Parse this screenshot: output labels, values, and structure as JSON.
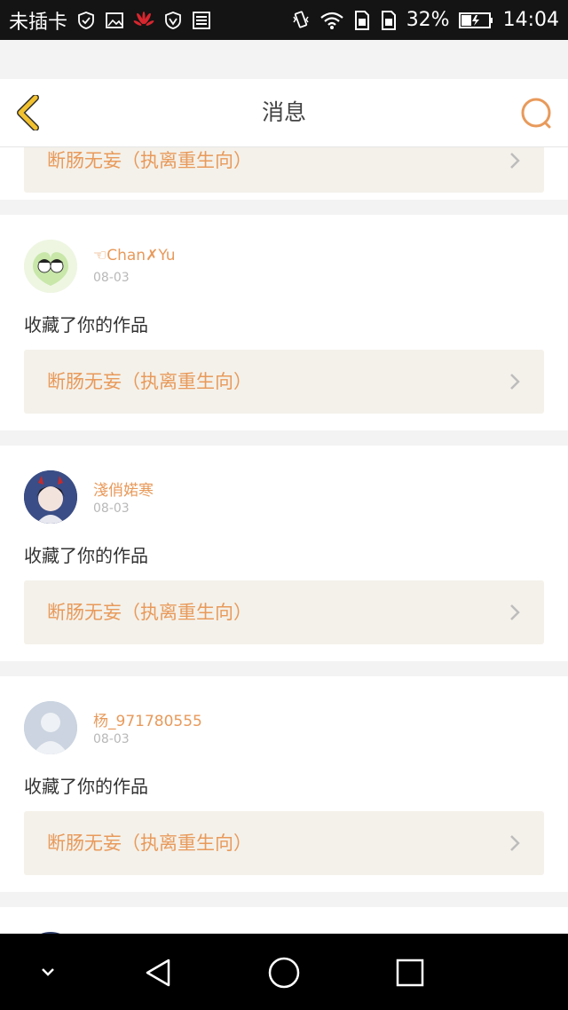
{
  "status_bar": {
    "carrier": "未插卡",
    "battery_percent": "32%",
    "time": "14:04",
    "icons": [
      "shield-check-icon",
      "image-icon",
      "huawei-logo-icon",
      "vpn-shield-icon",
      "storage-icon",
      "vibrate-icon",
      "wifi-icon",
      "sim1-icon",
      "sim2-icon",
      "battery-charging-icon"
    ]
  },
  "header": {
    "title": "消息",
    "back_icon": "chevron-left-icon",
    "search_icon": "search-icon"
  },
  "colors": {
    "accent": "#e89a5b",
    "back_arrow": "#f2c12e",
    "work_box_bg": "#f4f1ea"
  },
  "partial_top_card": {
    "work_title": "断肠无妄（执离重生向）"
  },
  "messages": [
    {
      "username": "☜Chan✗Yu",
      "date": "08-03",
      "action": "收藏了你的作品",
      "work_title": "断肠无妄（执离重生向）"
    },
    {
      "username": "淺俏婼寒",
      "date": "08-03",
      "action": "收藏了你的作品",
      "work_title": "断肠无妄（执离重生向）"
    },
    {
      "username": "杨_971780555",
      "date": "08-03",
      "action": "收藏了你的作品",
      "work_title": "断肠无妄（执离重生向）"
    }
  ],
  "nav_bar": {
    "icons": [
      "chevron-down-icon",
      "back-triangle-icon",
      "home-circle-icon",
      "recents-square-icon"
    ]
  }
}
